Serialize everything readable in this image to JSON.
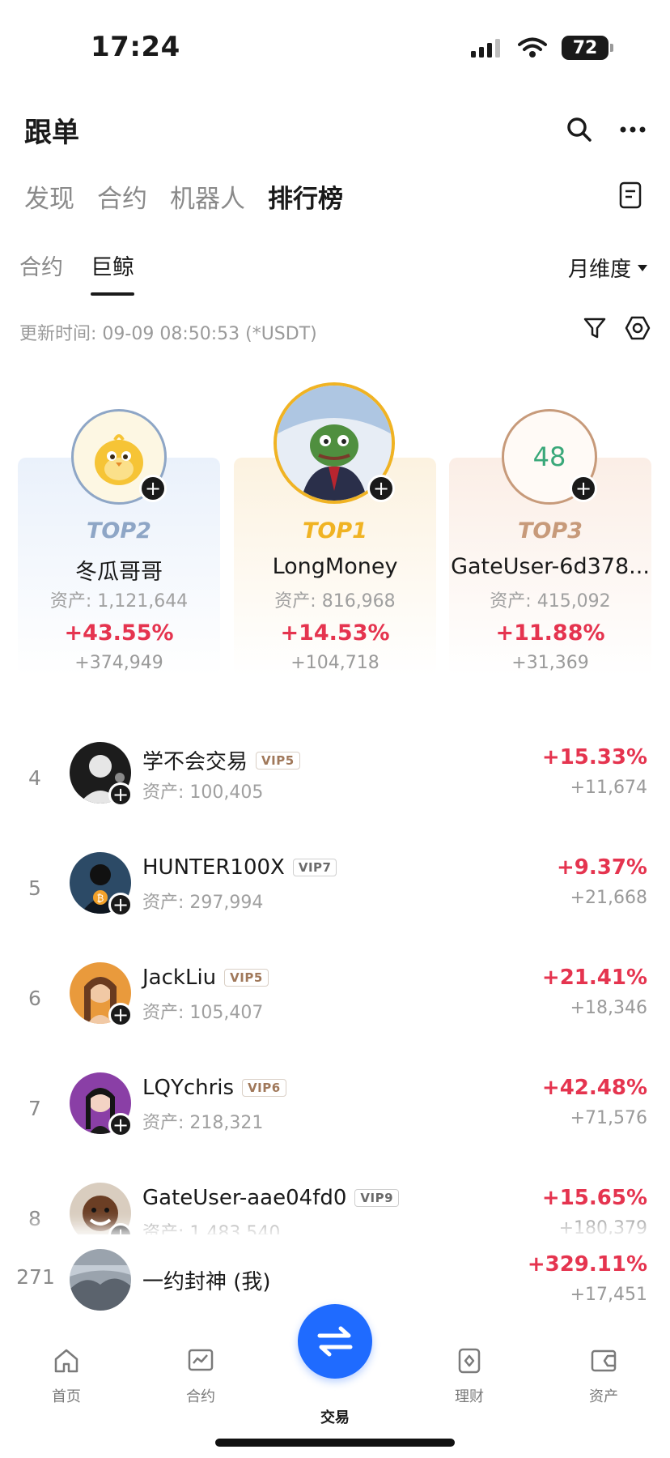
{
  "status_bar": {
    "time": "17:24",
    "battery": "72"
  },
  "header": {
    "title": "跟单"
  },
  "main_tabs": [
    "发现",
    "合约",
    "机器人",
    "排行榜"
  ],
  "sub_tabs": [
    "合约",
    "巨鲸"
  ],
  "dimension_select": {
    "label": "月维度"
  },
  "update_info": {
    "text": "更新时间: 09-09 08:50:53 (*USDT)"
  },
  "podium": [
    {
      "rank_label": "TOP2",
      "name": "冬瓜哥哥",
      "assets": "资产: 1,121,644",
      "pnl_pct": "+43.55%",
      "pnl": "+374,949"
    },
    {
      "rank_label": "TOP1",
      "name": "LongMoney",
      "assets": "资产: 816,968",
      "pnl_pct": "+14.53%",
      "pnl": "+104,718"
    },
    {
      "rank_label": "TOP3",
      "name": "GateUser-6d378...",
      "avatar_text": "48",
      "assets": "资产: 415,092",
      "pnl_pct": "+11.88%",
      "pnl": "+31,369"
    }
  ],
  "rows": [
    {
      "rank": "4",
      "name": "学不会交易",
      "vip": "VIP5",
      "assets": "资产: 100,405",
      "pnl_pct": "+15.33%",
      "pnl": "+11,674"
    },
    {
      "rank": "5",
      "name": "HUNTER100X",
      "vip": "VIP7",
      "assets": "资产: 297,994",
      "pnl_pct": "+9.37%",
      "pnl": "+21,668"
    },
    {
      "rank": "6",
      "name": "JackLiu",
      "vip": "VIP5",
      "assets": "资产: 105,407",
      "pnl_pct": "+21.41%",
      "pnl": "+18,346"
    },
    {
      "rank": "7",
      "name": "LQYchris",
      "vip": "VIP6",
      "assets": "资产: 218,321",
      "pnl_pct": "+42.48%",
      "pnl": "+71,576"
    },
    {
      "rank": "8",
      "name": "GateUser-aae04fd0",
      "vip": "VIP9",
      "assets": "资产: 1,483,540",
      "pnl_pct": "+15.65%",
      "pnl": "+180,379"
    }
  ],
  "me_row": {
    "rank": "271",
    "name": "一约封神 (我)",
    "pnl_pct": "+329.11%",
    "pnl": "+17,451"
  },
  "bottom_nav": [
    {
      "label": "首页",
      "icon": "home-icon"
    },
    {
      "label": "合约",
      "icon": "chart-icon"
    },
    {
      "label": "交易",
      "icon": "swap-icon"
    },
    {
      "label": "理财",
      "icon": "finance-icon"
    },
    {
      "label": "资产",
      "icon": "wallet-icon"
    }
  ],
  "colors": {
    "positive": "#e5344f",
    "accent": "#1f6bff",
    "top1": "#f0b323",
    "top2": "#8ea6c6",
    "top3": "#c79a7a"
  }
}
